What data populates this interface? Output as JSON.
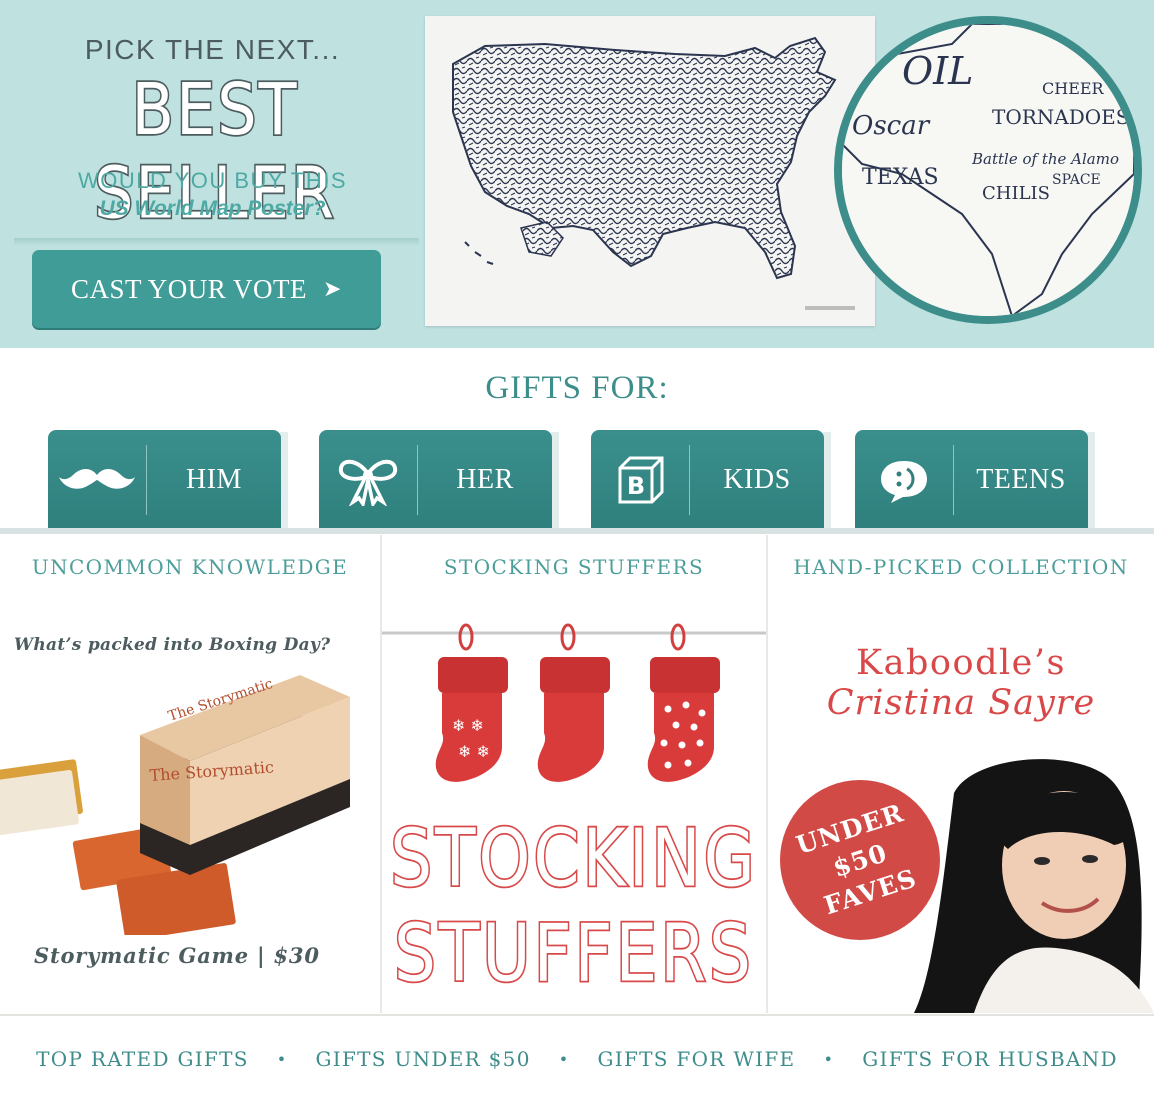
{
  "colors": {
    "hero_bg": "#bfe2e0",
    "teal": "#3d8e8b",
    "teal_button": "#3f9c97",
    "red_accent": "#d94848",
    "slate_text": "#4d5c5f"
  },
  "hero": {
    "pretitle": "PICK THE NEXT...",
    "title": "BEST SELLER",
    "question_line1": "WOULD YOU BUY THIS",
    "question_line2": "US World Map Poster?",
    "cta_label": "CAST YOUR VOTE",
    "cta_icon": "play-arrow-icon",
    "map_image": "typographic-us-map",
    "zoom_words": [
      "OIL",
      "Oscar",
      "TORNADOES",
      "CHEER",
      "Battle of the Alamo",
      "CHILIS",
      "SPACE CENTER"
    ]
  },
  "gifts": {
    "heading": "GIFTS FOR:",
    "tabs": [
      {
        "label": "HIM",
        "icon": "mustache-icon"
      },
      {
        "label": "HER",
        "icon": "bow-icon"
      },
      {
        "label": "KIDS",
        "icon": "block-b-icon"
      },
      {
        "label": "TEENS",
        "icon": "speech-bubble-icon"
      }
    ]
  },
  "columns": {
    "uncommon": {
      "heading": "UNCOMMON KNOWLEDGE",
      "question": "What’s packed into Boxing Day?",
      "product_box_text": "The Storymatic",
      "caption": "Storymatic Game | $30"
    },
    "stocking": {
      "heading": "STOCKING STUFFERS",
      "title_line1": "STOCKING",
      "title_line2": "STUFFERS"
    },
    "handpicked": {
      "heading": "HAND-PICKED COLLECTION",
      "line1": "Kaboodle’s",
      "line2": "Cristina Sayre",
      "badge": [
        "UNDER",
        "$50",
        "FAVES"
      ]
    }
  },
  "footer": {
    "links": [
      "TOP RATED GIFTS",
      "GIFTS UNDER $50",
      "GIFTS FOR WIFE",
      "GIFTS FOR HUSBAND"
    ],
    "separator": "•"
  }
}
